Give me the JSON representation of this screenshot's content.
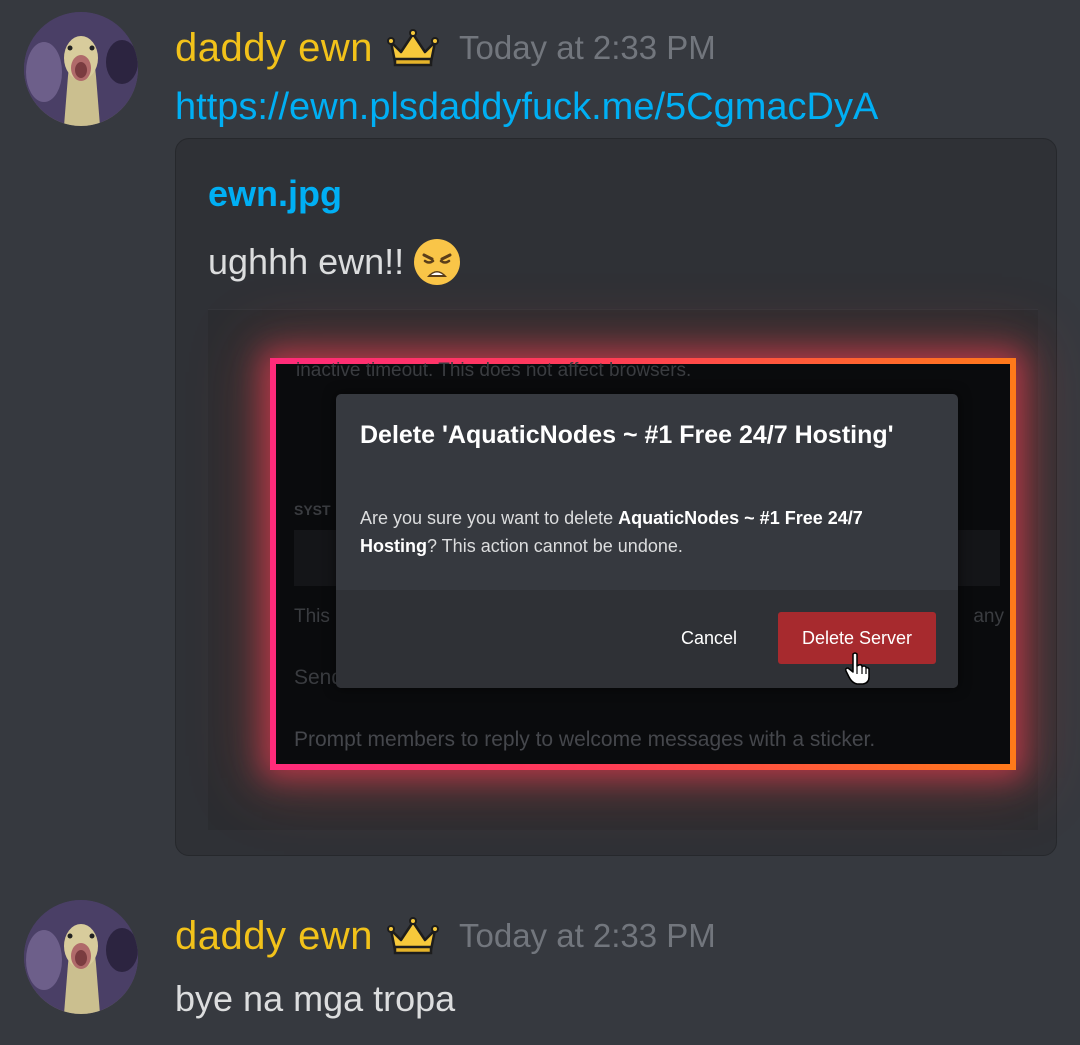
{
  "messages": [
    {
      "author": "daddy ewn",
      "badge_icon": "crown-icon",
      "timestamp": "Today at 2:33 PM",
      "link": "https://ewn.plsdaddyfuck.me/5CgmacDyA",
      "embed": {
        "title": "ewn.jpg",
        "description": "ughhh ewn!!",
        "description_emoji": "weary-face-icon",
        "image": {
          "background_text": {
            "top": "inactive timeout. This does not affect browsers.",
            "section_label": "SYST",
            "left_fragment": "This",
            "right_fragment": "any",
            "send_fragment": "Send",
            "prompt": "Prompt members to reply to welcome messages with a sticker."
          },
          "dialog": {
            "title": "Delete 'AquaticNodes ~ #1 Free 24/7 Hosting'",
            "body_prefix": "Are you sure you want to delete ",
            "body_bold": "AquaticNodes ~ #1 Free 24/7 Hosting",
            "body_suffix": "? This action cannot be undone.",
            "cancel_label": "Cancel",
            "delete_label": "Delete Server"
          }
        }
      }
    },
    {
      "author": "daddy ewn",
      "badge_icon": "crown-icon",
      "timestamp": "Today at 2:33 PM",
      "text": "bye na mga tropa"
    }
  ],
  "colors": {
    "background": "#36393f",
    "username": "#f2c21a",
    "link": "#00aff4",
    "timestamp": "#72767d",
    "embed_bg": "#2f3136",
    "danger_button": "#a72a2e",
    "glow_start": "#ff2b7a",
    "glow_end": "#ff7a1a"
  }
}
